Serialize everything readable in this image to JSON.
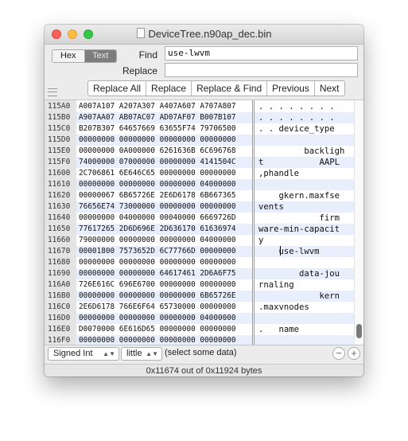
{
  "window": {
    "title": "DeviceTree.n90ap_dec.bin"
  },
  "mode": {
    "hex_label": "Hex",
    "text_label": "Text",
    "selected": "Text"
  },
  "find": {
    "label": "Find",
    "value": "use-lwvm"
  },
  "replace": {
    "label": "Replace",
    "value": ""
  },
  "buttons": [
    "Replace All",
    "Replace",
    "Replace & Find",
    "Previous",
    "Next"
  ],
  "rows": [
    {
      "off": "115A0",
      "hex": "A007A107 A207A307 A407A607 A707A807",
      "text": ". . . . . . . ."
    },
    {
      "off": "115B0",
      "hex": "A907AA07 AB07AC07 AD07AF07 B007B107",
      "text": ". . . . . . . ."
    },
    {
      "off": "115C0",
      "hex": "B207B307 64657669 63655F74 79706500",
      "text": ". . device_type"
    },
    {
      "off": "115D0",
      "hex": "00000000 00000000 00000000 00000000",
      "text": ""
    },
    {
      "off": "115E0",
      "hex": "00000000 0A000000 6261636B 6C696768",
      "text": "         backligh"
    },
    {
      "off": "115F0",
      "hex": "74000000 07000000 00000000 4141504C",
      "text": "t           AAPL"
    },
    {
      "off": "11600",
      "hex": "2C706861 6E646C65 00000000 00000000",
      "text": ",phandle"
    },
    {
      "off": "11610",
      "hex": "00000000 00000000 00000000 04000000",
      "text": ""
    },
    {
      "off": "11620",
      "hex": "00000067 6B65726E 2E6D6178 6B667365",
      "text": "    gkern.maxfse"
    },
    {
      "off": "11630",
      "hex": "76656E74 73000000 00000000 00000000",
      "text": "vents"
    },
    {
      "off": "11640",
      "hex": "00000000 04000000 00040000 6669726D",
      "text": "            firm"
    },
    {
      "off": "11650",
      "hex": "77617265 2D6D696E 2D636170 61636974",
      "text": "ware-min-capacit"
    },
    {
      "off": "11660",
      "hex": "79000000 00000000 00000000 04000000",
      "text": "y"
    },
    {
      "off": "11670",
      "hex": "00001800 7573652D 6C77766D 00000000",
      "text": "    use-lwvm"
    },
    {
      "off": "11680",
      "hex": "00000000 00000000 00000000 00000000",
      "text": ""
    },
    {
      "off": "11690",
      "hex": "00000000 00000000 64617461 2D6A6F75",
      "text": "        data-jou"
    },
    {
      "off": "116A0",
      "hex": "726E616C 696E6700 00000000 00000000",
      "text": "rnaling"
    },
    {
      "off": "116B0",
      "hex": "00000000 00000000 00000000 6B65726E",
      "text": "            kern"
    },
    {
      "off": "116C0",
      "hex": "2E6D6178 766E6F64 65730000 00000000",
      "text": ".maxvnodes"
    },
    {
      "off": "116D0",
      "hex": "00000000 00000000 00000000 04000000",
      "text": ""
    },
    {
      "off": "116E0",
      "hex": "D0070000 6E616D65 00000000 00000000",
      "text": ".   name"
    },
    {
      "off": "116F0",
      "hex": "00000000 00000000 00000000 00000000",
      "text": ""
    }
  ],
  "footer_controls": {
    "type_select": "Signed Int",
    "endian_select": "little",
    "selection_info": "(select some data)",
    "minus": "−",
    "plus": "+"
  },
  "status": {
    "text": "0x11674 out of 0x11924 bytes"
  }
}
